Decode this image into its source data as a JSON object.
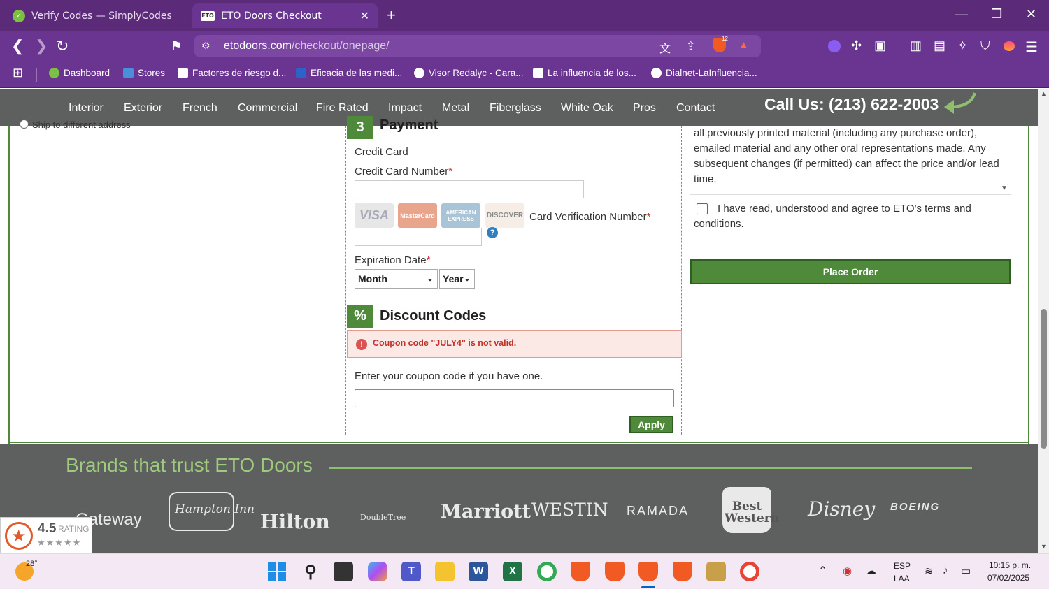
{
  "browser": {
    "tabs": [
      {
        "title": "Verify Codes — SimplyCodes",
        "active": false
      },
      {
        "title": "ETO Doors Checkout",
        "active": true
      }
    ],
    "url_domain": "etodoors.com",
    "url_path": "/checkout/onepage/",
    "shield_count": "12",
    "bookmarks": [
      "Dashboard",
      "Stores",
      "Factores de riesgo d...",
      "Eficacia de las medi...",
      "Visor Redalyc - Cara...",
      "La influencia de los...",
      "Dialnet-LaInfluencia..."
    ]
  },
  "site": {
    "nav": [
      "Interior",
      "Exterior",
      "French",
      "Commercial",
      "Fire Rated",
      "Impact",
      "Metal",
      "Fiberglass",
      "White Oak",
      "Pros",
      "Contact"
    ],
    "call_us": "Call Us: (213) 622-2003"
  },
  "checkout": {
    "ship_different": "Ship to different address",
    "payment": {
      "step": "3",
      "title": "Payment",
      "method": "Credit Card",
      "cc_number_label": "Credit Card Number",
      "card_types": [
        "VISA",
        "MasterCard",
        "AMERICAN EXPRESS",
        "DISCOVER"
      ],
      "cvv_label": "Card Verification Number",
      "cvv_help": "?",
      "exp_label": "Expiration Date",
      "month": "Month",
      "year": "Year",
      "required_mark": "*"
    },
    "discount": {
      "badge": "%",
      "title": "Discount Codes",
      "error": "Coupon code \"JULY4\" is not valid.",
      "prompt": "Enter your coupon code if you have one.",
      "apply": "Apply",
      "coupon_value": ""
    },
    "terms": {
      "text": "all previously printed material (including any purchase order), emailed material and any other oral representations made. Any subsequent changes (if permitted) can affect the price and/or lead time.",
      "agree": "I have read, understood and agree to ETO's terms and conditions.",
      "agreed": false
    },
    "place_order": "Place Order"
  },
  "brands": {
    "title": "Brands that trust ETO Doors",
    "logos": [
      "Gateway",
      "Hampton Inn",
      "Hilton",
      "DoubleTree",
      "Marriott",
      "WESTIN",
      "RAMADA",
      "Best Western",
      "Disney",
      "BOEING"
    ]
  },
  "rating": {
    "score": "4.5",
    "label": "RATING",
    "stars": "★★★★★"
  },
  "taskbar": {
    "weather": "28°",
    "lang": "ESP",
    "lang2": "LAA",
    "time": "10:15 p. m.",
    "date": "07/02/2025"
  }
}
